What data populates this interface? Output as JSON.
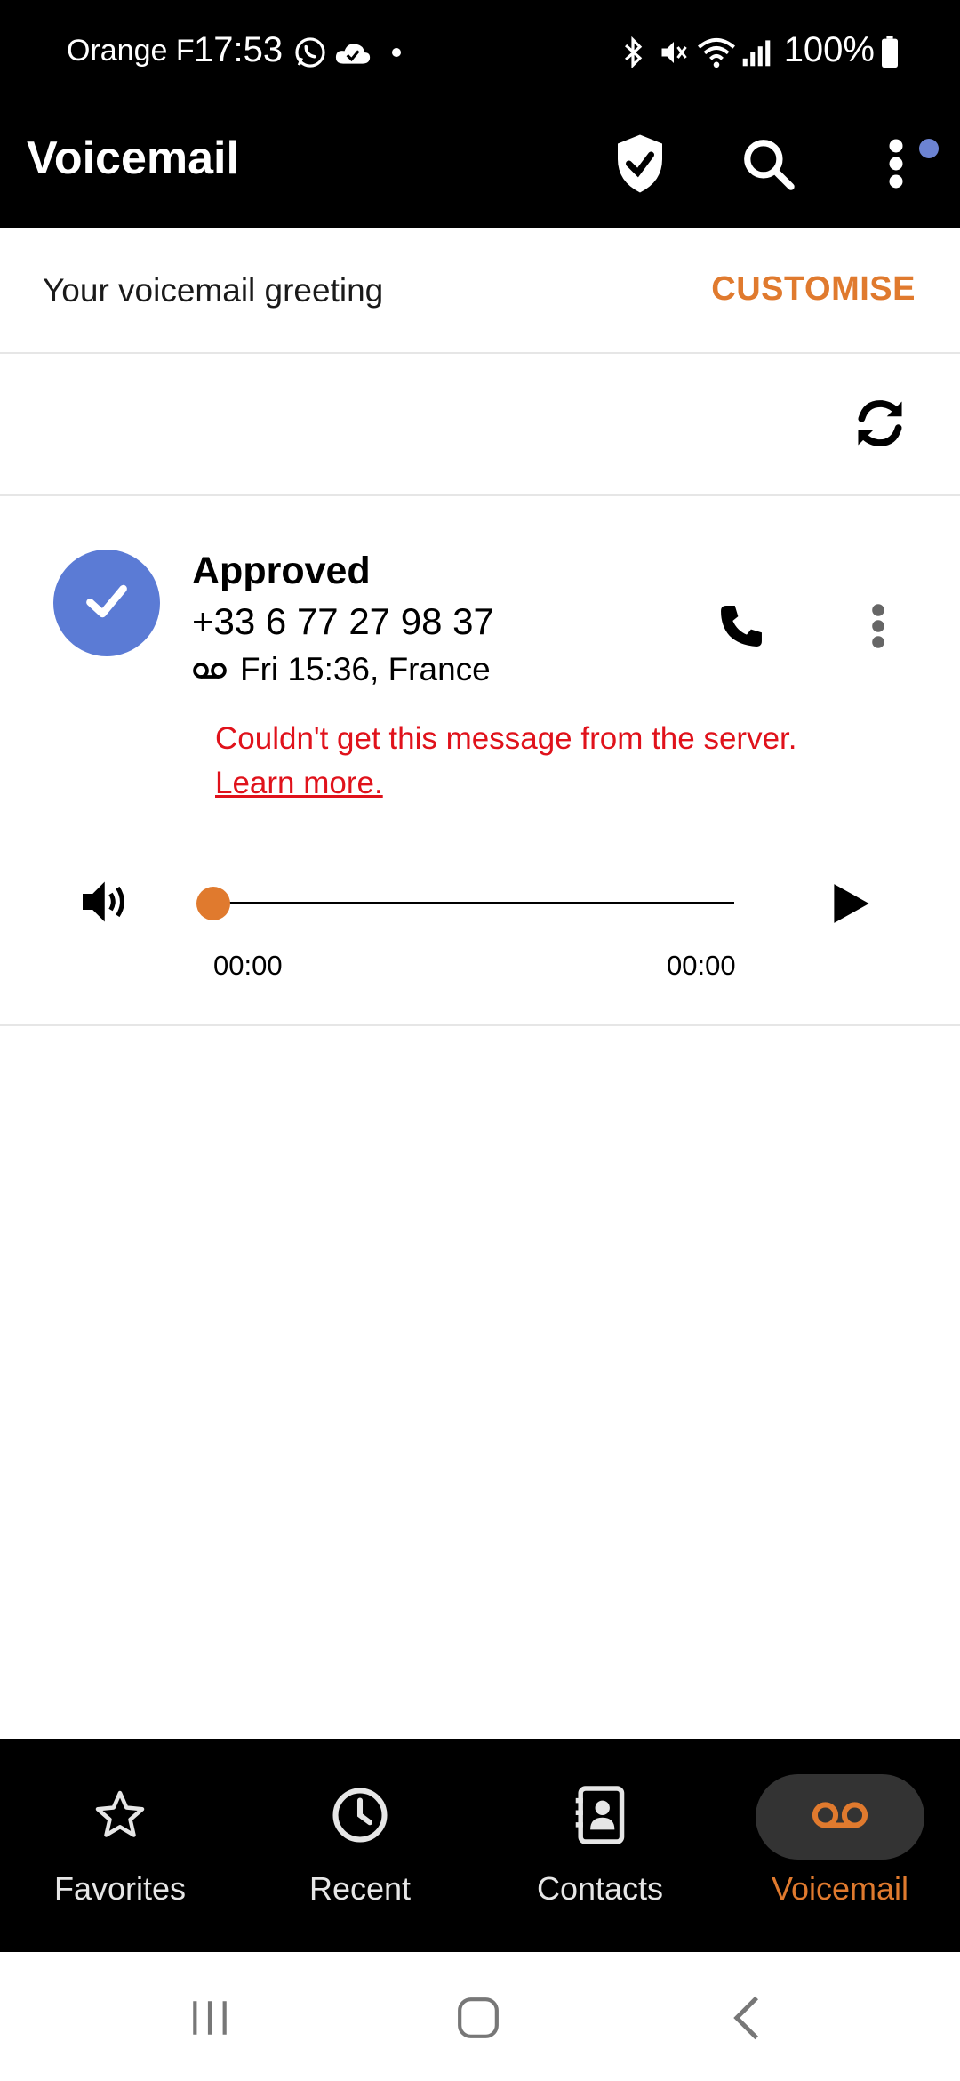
{
  "status_bar": {
    "carrier": "Orange F",
    "time": "17:53",
    "battery": "100%",
    "icons": [
      "whatsapp-icon",
      "cloud-check-icon",
      "dot-icon",
      "bluetooth-icon",
      "mute-icon",
      "wifi-icon",
      "signal-icon",
      "battery-icon"
    ]
  },
  "app_bar": {
    "title": "Voicemail",
    "icons": [
      "shield-check-icon",
      "search-icon",
      "more-vert-icon"
    ]
  },
  "greeting": {
    "label": "Your voicemail greeting",
    "action": "CUSTOMISE"
  },
  "voicemail": {
    "name": "Approved",
    "number": "+33 6 77 27 98 37",
    "meta": "Fri 15:36, France",
    "error": "Couldn't get this message from the server.",
    "learn_more": "Learn more.",
    "time_start": "00:00",
    "time_end": "00:00",
    "progress": 0
  },
  "bottom_nav": {
    "items": [
      {
        "label": "Favorites",
        "icon": "star-icon"
      },
      {
        "label": "Recent",
        "icon": "clock-icon"
      },
      {
        "label": "Contacts",
        "icon": "contacts-icon"
      },
      {
        "label": "Voicemail",
        "icon": "voicemail-icon",
        "active": true
      }
    ]
  },
  "colors": {
    "accent": "#e07a2e",
    "avatar": "#5b7bd5",
    "error": "#e0121b",
    "badge": "#6c83d2"
  }
}
